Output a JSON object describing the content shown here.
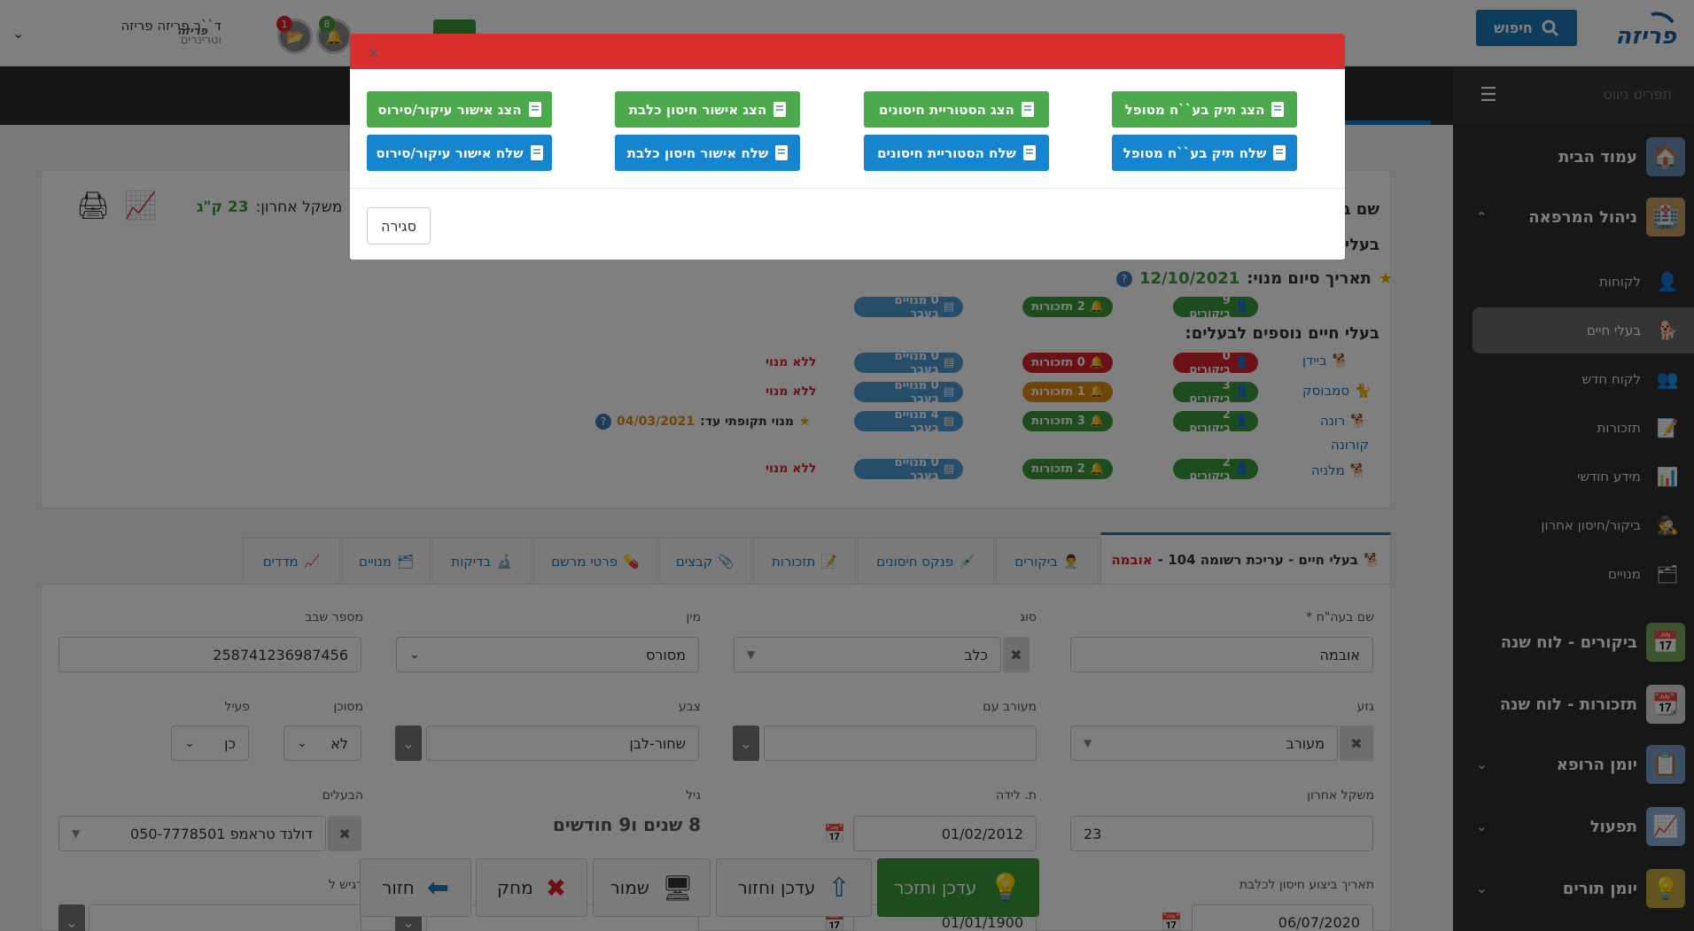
{
  "topbar": {
    "logo_text": "פריזה",
    "search_label": "חיפוש",
    "user_name": "ד``ר פריזה פריזה",
    "user_role": "וטרינרים",
    "notif_bell_count": "8",
    "notif_folder_count": "1"
  },
  "sidebar": {
    "header_label": "תפריט ניווט",
    "items": [
      {
        "label": "עמוד הבית",
        "icon": "house-icon"
      },
      {
        "label": "ניהול המרפאה",
        "icon": "clinic-icon"
      },
      {
        "label": "ביקורים - לוח שנה",
        "icon": "visit-calendar-icon"
      },
      {
        "label": "תזכורות - לוח שנה",
        "icon": "calendar-icon"
      },
      {
        "label": "יומן הרופא",
        "icon": "diary-icon"
      },
      {
        "label": "תפעול",
        "icon": "operations-icon"
      },
      {
        "label": "יומן תורים",
        "icon": "appointments-icon"
      }
    ],
    "subitems": [
      {
        "label": "לקוחות"
      },
      {
        "label": "בעלי חיים"
      },
      {
        "label": "לקוח חדש"
      },
      {
        "label": "תזכורות"
      },
      {
        "label": "מידע חודשי"
      },
      {
        "label": "ביקור/חיסון אחרון"
      },
      {
        "label": "מנויים"
      }
    ]
  },
  "page": {
    "title": "בעלי חיים"
  },
  "card": {
    "name_label": "שם ב",
    "owner_label": "בעלי",
    "last_weight_label": "משקל אחרון:",
    "last_weight_value": "23 ק\"ג",
    "sub_end_label": "תאריך סיום מנוי:",
    "sub_end_value": "12/10/2021",
    "main_pills": {
      "visits": "9 ביקורים",
      "reminders": "2 תזכורות",
      "subs": "0 מנויים בעבר"
    },
    "more_pets_label": "בעלי חיים נוספים לבעלים:",
    "pets": [
      {
        "name": "ביידן",
        "visits": "0 ביקורים",
        "reminders": "0 תזכורות",
        "subs": "0 מנויים בעבר",
        "status": "ללא מנוי",
        "vcolor": "r",
        "rcolor": "r"
      },
      {
        "name": "סמבוסק",
        "visits": "3 ביקורים",
        "reminders": "1 תזכורות",
        "subs": "0 מנויים בעבר",
        "status": "ללא מנוי",
        "vcolor": "g",
        "rcolor": "o"
      },
      {
        "name": "רונה",
        "visits": "2 ביקורים",
        "reminders": "3 תזכורות",
        "subs": "4 מנויים בעבר",
        "status": "מנוי תקופתי עד:",
        "status_date": "04/03/2021",
        "vcolor": "g",
        "rcolor": "g"
      },
      {
        "name": "מלניה",
        "visits": "2 ביקורים",
        "reminders": "2 תזכורות",
        "subs": "0 מנויים בעבר",
        "status": "ללא מנוי",
        "vcolor": "g",
        "rcolor": "g"
      }
    ],
    "extra_pet_name": "קורונה"
  },
  "tabs": [
    {
      "label": "בעלי חיים - עריכת רשומה 104 -",
      "highlight": "אובמה"
    },
    {
      "label": "ביקורים"
    },
    {
      "label": "פנקס חיסונים"
    },
    {
      "label": "תזכורות"
    },
    {
      "label": "קבצים"
    },
    {
      "label": "פרטי מרשם"
    },
    {
      "label": "בדיקות"
    },
    {
      "label": "מנויים"
    },
    {
      "label": "מדדים"
    }
  ],
  "form": {
    "pet_name_label": "שם בעה\"ח *",
    "pet_name_value": "אובמה",
    "type_label": "סוג",
    "type_value": "כלב",
    "sex_label": "מין",
    "sex_value": "מסורס",
    "chip_label": "מספר שבב",
    "chip_value": "258741236987456",
    "breed_label": "גזע",
    "breed_value": "מעורב",
    "mixed_label": "מעורב עם",
    "mixed_value": "",
    "color_label": "צבע",
    "color_value": "שחור-לבן",
    "dangerous_label": "מסוכן",
    "dangerous_value": "לא",
    "active_label": "פעיל",
    "active_value": "כן",
    "weight_label": "משקל אחרון",
    "weight_value": "23",
    "birth_label": "ת. לידה",
    "birth_value": "01/02/2012",
    "age_label": "גיל",
    "age_value": "8 שנים ו9 חודשים",
    "owners_label": "הבעלים",
    "owners_value": "דולנד טראמפ 050-7778501",
    "rabies_label": "תאריך ביצוע חיסון לכלבת",
    "rabies_value": "06/07/2020",
    "date2_value": "01/01/1900",
    "register_label": "רגיש ל"
  },
  "buttons": {
    "update_remember": "עדכן ותזכר",
    "update_return": "עדכן וחזור",
    "save": "שמור",
    "delete": "מחק",
    "back": "חזור"
  },
  "modal": {
    "buttons_green": [
      "הצג תיק בע``ח מטופל",
      "הצג הסטוריית חיסונים",
      "הצג אישור חיסון כלבת",
      "הצג אישור עיקור/סירוס"
    ],
    "buttons_blue": [
      "שלח תיק בע``ח מטופל",
      "שלח הסטוריית חיסונים",
      "שלח אישור חיסון כלבת",
      "שלח אישור עיקור/סירוס"
    ],
    "close_label": "סגירה"
  },
  "colors": {
    "accent": "#1a78b8",
    "green": "#4caa4c",
    "red": "#d9302f",
    "sidebar": "#2f2f2f"
  }
}
